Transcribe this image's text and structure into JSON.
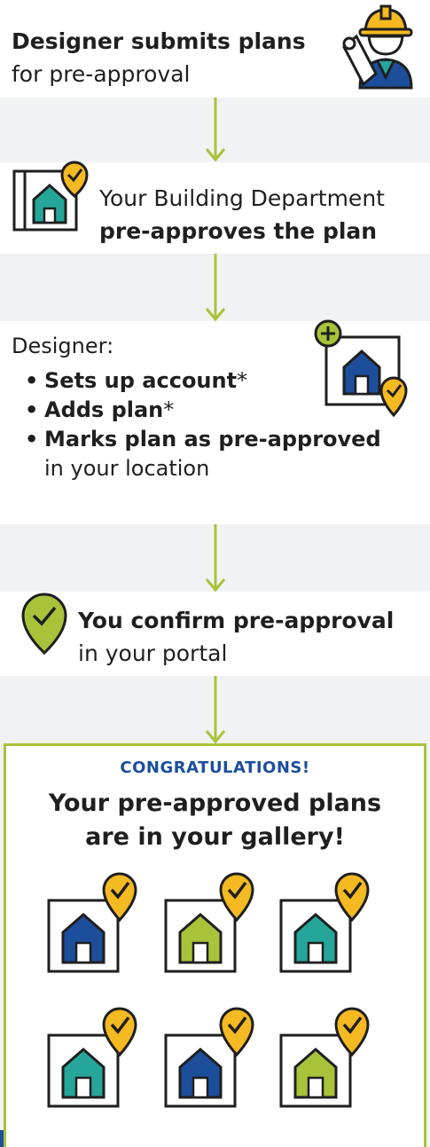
{
  "steps": {
    "step1": {
      "title": "Designer submits plans",
      "subtitle": "for pre-approval"
    },
    "step2": {
      "line1": "Your Building Department",
      "line2": "pre-approves the plan"
    },
    "step3": {
      "lead": "Designer:",
      "b1_bold": "Sets up account",
      "b1_mark": "*",
      "b2_bold": "Adds plan",
      "b2_mark": "*",
      "b3_bold": "Marks plan as pre-approved",
      "b3_cont": "in your location"
    },
    "step4": {
      "title": "You confirm pre-approval",
      "subtitle": "in your portal"
    }
  },
  "final": {
    "eyebrow": "CONGRATULATIONS!",
    "title_line1": "Your pre-approved plans",
    "title_line2": "are in your gallery!"
  },
  "colors": {
    "green": "#a8c23a",
    "navy": "#1c4e9c",
    "teal": "#26a69a",
    "yellow": "#f5b921",
    "dark": "#1f1f1f"
  },
  "icons": [
    "worker-icon",
    "blueprint-house-icon",
    "add-house-icon",
    "check-pin-icon",
    "house-pin-icon"
  ],
  "gallery": [
    {
      "color": "navy"
    },
    {
      "color": "green"
    },
    {
      "color": "teal"
    },
    {
      "color": "teal"
    },
    {
      "color": "navy"
    },
    {
      "color": "green"
    }
  ]
}
